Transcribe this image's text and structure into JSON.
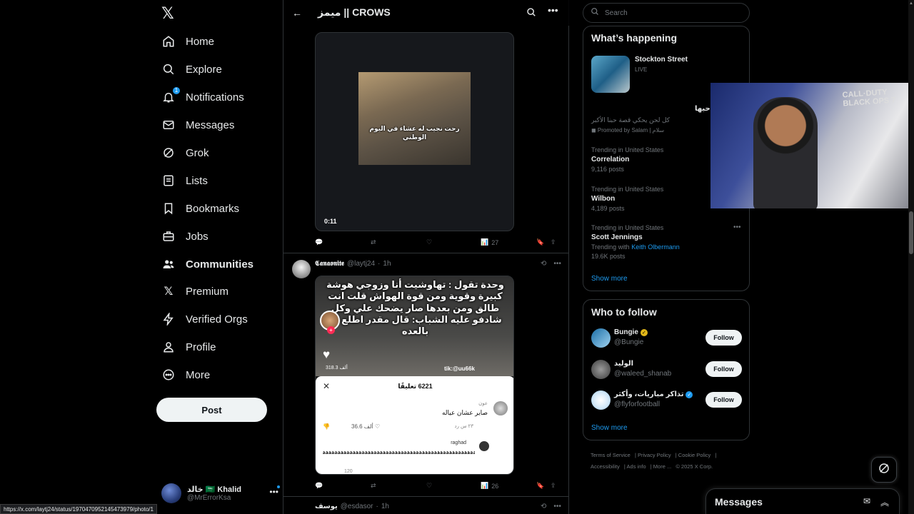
{
  "nav": {
    "items": [
      {
        "label": "Home",
        "icon": "home-icon"
      },
      {
        "label": "Explore",
        "icon": "search-icon"
      },
      {
        "label": "Notifications",
        "icon": "bell-icon",
        "badge": "1"
      },
      {
        "label": "Messages",
        "icon": "envelope-icon"
      },
      {
        "label": "Grok",
        "icon": "grok-icon"
      },
      {
        "label": "Lists",
        "icon": "list-icon"
      },
      {
        "label": "Bookmarks",
        "icon": "bookmark-icon"
      },
      {
        "label": "Jobs",
        "icon": "briefcase-icon"
      },
      {
        "label": "Communities",
        "icon": "people-icon",
        "active": true
      },
      {
        "label": "Premium",
        "icon": "x-logo-icon"
      },
      {
        "label": "Verified Orgs",
        "icon": "lightning-icon"
      },
      {
        "label": "Profile",
        "icon": "person-icon"
      },
      {
        "label": "More",
        "icon": "more-circle-icon"
      }
    ],
    "post_label": "Post",
    "account": {
      "name": "خالد 🇸🇦 Khalid",
      "handle": "@MrErrorKsa"
    }
  },
  "timeline": {
    "title": "ميمز || CROWS",
    "post1": {
      "video_caption": "رحت نجيب له عشاء في اليوم الوطني",
      "duration": "0:11",
      "views": "27"
    },
    "post2": {
      "name": "𝕮𝖆𝖓𝖆𝖔𝖓𝖎𝖙𝖊",
      "handle": "@laytj24",
      "time": "1h",
      "image_text": "وحدة تقول : تهاوشيت أنا وزوجي هوشة كبيرة وقوية ومن قوة الهواش قلت انت طالق ومن بعدها صار يضحك علي وكل شادفو عليه الشباب: قال مقدر اطلع انا بالعده",
      "likes_overlay": "318.3 ألف",
      "tik_handle": "tik:@uu66k",
      "comments_title": "6221 تعليقًا",
      "c1_name": "عون",
      "c1_text": "صاير عشان عياله",
      "c1_meta": "٢٣ س  رد",
      "c1_likes": "36.6 ألف",
      "c2_name": "raghad",
      "c2_text": "ﻫﻫﻫﻫﻫﻫﻫﻫﻫﻫﻫﻫﻫﻫﻫﻫﻫﻫﻫﻫﻫﻫﻫﻫﻫﻫﻫﻫﻫﻫﻫﻫﻫﻫﻫﻫﻫﻫﻫﻫﻫﻫﻫﻫﻫﻫﻫﻫﻫﻫﻫﻫﻫﻫﻫﻫﻫﻫﻫﻫﻫﻫﻫﻫ",
      "c2_meta": "120",
      "views": "26"
    },
    "post3": {
      "name": "يوسف",
      "handle": "@esdasor",
      "time": "1h"
    }
  },
  "right": {
    "search_placeholder": "Search",
    "happening_title": "What’s happening",
    "featured": {
      "title": "Stockton Street",
      "status": "LIVE"
    },
    "promo": {
      "text": "كل لحن يحكي قصة حبنا الأكبر",
      "promoted": "Promoted by Salam | سلام"
    },
    "trends": [
      {
        "context": "Trending in United States",
        "title": "Correlation",
        "count": "9,116 posts"
      },
      {
        "context": "Trending in United States",
        "title": "Wilbon",
        "count": "4,189 posts"
      },
      {
        "context": "Trending in United States",
        "title": "Scott Jennings",
        "with": "Trending with",
        "link": "Keith Olbermann",
        "count": "19.6K posts"
      }
    ],
    "show_more": "Show more",
    "follow_title": "Who to follow",
    "follow": [
      {
        "name": "Bungie",
        "handle": "@Bungie",
        "badge": "gold",
        "btn": "Follow"
      },
      {
        "name": "الوليد",
        "handle": "@waleed_shanab",
        "btn": "Follow"
      },
      {
        "name": "تذاكر مباريات، وأكثر",
        "handle": "@flyforfootball",
        "badge": "blue",
        "btn": "Follow"
      }
    ],
    "footer": [
      "Terms of Service",
      "Privacy Policy",
      "Cookie Policy",
      "Accessibility",
      "Ads info",
      "More ...",
      "© 2025 X Corp."
    ]
  },
  "webcam": {
    "overlay_text": "حبها",
    "cod_text": "CALL·DUTY BLACK OPS 7"
  },
  "messages": {
    "title": "Messages"
  },
  "status_url": "https://x.com/laytj24/status/1970470952145473979/photo/1",
  "colors": {
    "accent": "#1d9bf0",
    "bg": "#000000",
    "border": "#2f3336",
    "muted": "#71767b"
  }
}
